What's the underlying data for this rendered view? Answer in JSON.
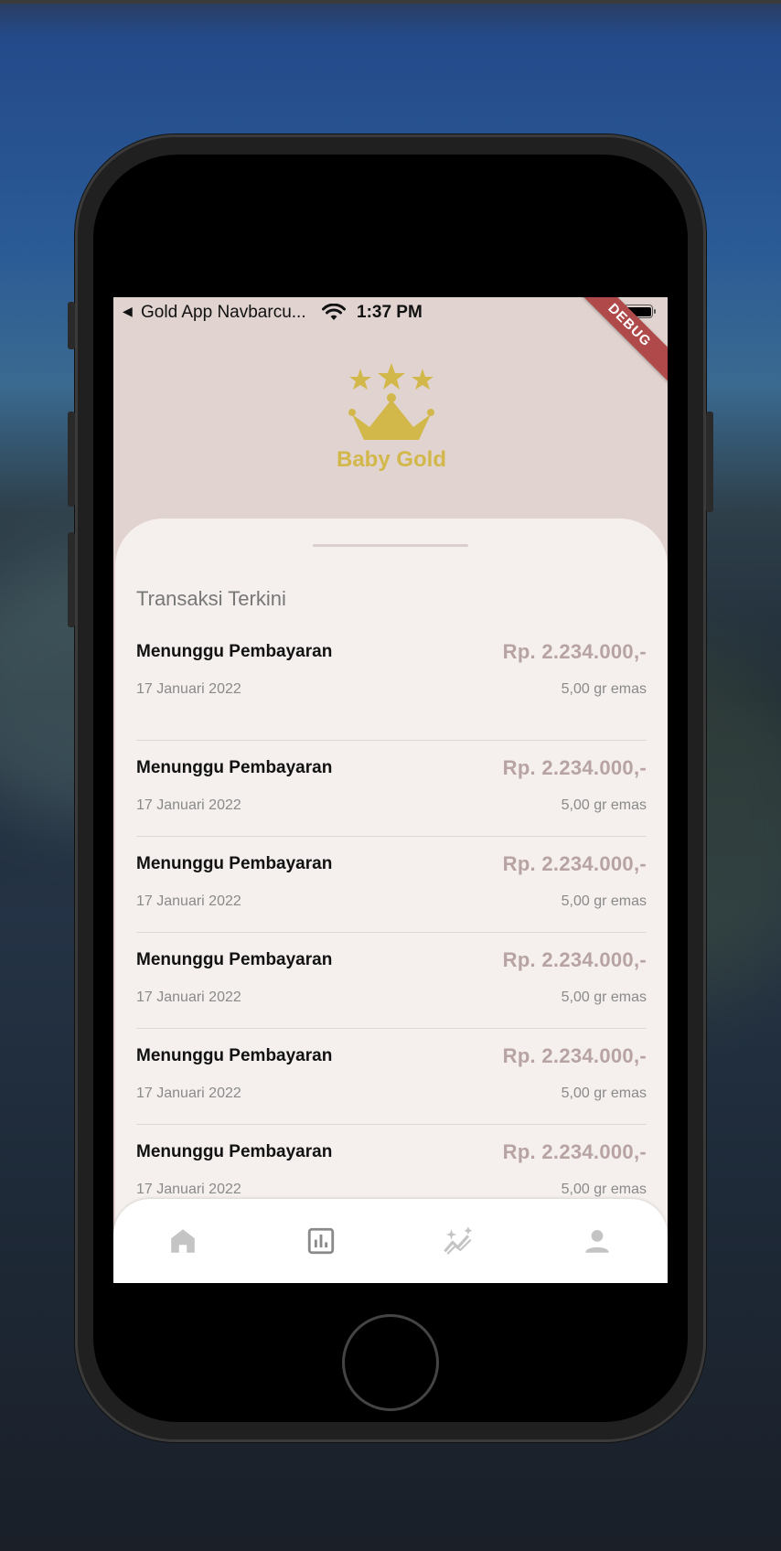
{
  "status_bar": {
    "back_glyph": "◀",
    "app_name": "Gold App Navbarcu...",
    "time": "1:37 PM"
  },
  "debug_banner": "DEBUG",
  "logo": {
    "text": "Baby Gold",
    "color": "#d2b84a"
  },
  "section_title": "Transaksi Terkini",
  "transactions": [
    {
      "status": "Menunggu Pembayaran",
      "amount": "Rp. 2.234.000,-",
      "date": "17 Januari 2022",
      "weight": "5,00 gr emas"
    },
    {
      "status": "Menunggu Pembayaran",
      "amount": "Rp. 2.234.000,-",
      "date": "17 Januari 2022",
      "weight": "5,00 gr emas"
    },
    {
      "status": "Menunggu Pembayaran",
      "amount": "Rp. 2.234.000,-",
      "date": "17 Januari 2022",
      "weight": "5,00 gr emas"
    },
    {
      "status": "Menunggu Pembayaran",
      "amount": "Rp. 2.234.000,-",
      "date": "17 Januari 2022",
      "weight": "5,00 gr emas"
    },
    {
      "status": "Menunggu Pembayaran",
      "amount": "Rp. 2.234.000,-",
      "date": "17 Januari 2022",
      "weight": "5,00 gr emas"
    },
    {
      "status": "Menunggu Pembayaran",
      "amount": "Rp. 2.234.000,-",
      "date": "17 Januari 2022",
      "weight": "5,00 gr emas"
    }
  ],
  "nav": [
    {
      "icon": "home-icon",
      "active": false
    },
    {
      "icon": "bar-chart-icon",
      "active": true
    },
    {
      "icon": "trending-sparkle-icon",
      "active": false
    },
    {
      "icon": "person-icon",
      "active": false
    }
  ],
  "colors": {
    "header_bg": "#e0d3d0",
    "sheet_bg": "#f5f0ee",
    "amount": "#b7a3a2",
    "gold": "#d2b84a",
    "debug": "#b04a4a",
    "nav_active": "#8a8a8a",
    "nav_inactive": "#c4c4c4"
  }
}
